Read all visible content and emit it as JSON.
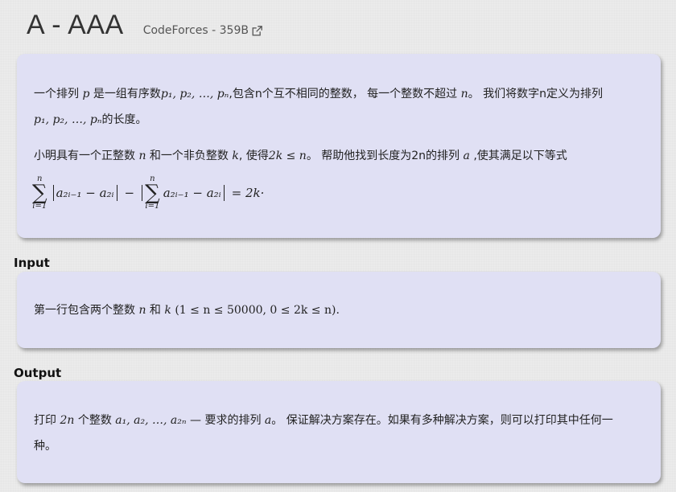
{
  "header": {
    "title": "A - AAA",
    "source": "CodeForces - 359B",
    "source_icon": "external-link-icon"
  },
  "statement": {
    "line1_a": "一个排列 ",
    "line1_p": "p",
    "line1_b": " 是一组有序数",
    "line1_seq": "p₁, p₂, …, pₙ",
    "line1_c": ",包含n个互不相同的整数， 每一个整数不超过 ",
    "line1_n": "n",
    "line1_d": "。 我们将数字n定义为排列",
    "line2_seq": "p₁, p₂, …, pₙ",
    "line2_a": "的长度。",
    "line3_a": "小明具有一个正整数 ",
    "line3_n": "n",
    "line3_b": " 和一个非负整数 ",
    "line3_k": "k",
    "line3_c": ", 使得",
    "line3_ineq": "2k ≤ n",
    "line3_d": "。 帮助他找到长度为2n的排列 ",
    "line3_a_var": "a",
    "line3_e": " ,使其满足以下等式",
    "formula": {
      "sum_top": "n",
      "sum_bottom": "i=1",
      "term": "a₂ᵢ₋₁ − a₂ᵢ",
      "minus": "−",
      "rhs": "= 2k·"
    }
  },
  "input": {
    "label": "Input",
    "text_a": "第一行包含两个整数 ",
    "text_n": "n",
    "text_b": " 和 ",
    "text_k": "k",
    "text_c": " (1 ≤ n ≤ 50000, 0 ≤ 2k ≤ n)."
  },
  "output": {
    "label": "Output",
    "line1_a": "打印 ",
    "line1_2n": "2n",
    "line1_b": " 个整数 ",
    "line1_seq": "a₁, a₂, …, a₂ₙ",
    "line1_c": " — 要求的排列 ",
    "line1_a_var": "a",
    "line1_d": "。 保证解决方案存在。如果有多种解决方案，则可以打印其中任何一",
    "line2": "种。"
  }
}
